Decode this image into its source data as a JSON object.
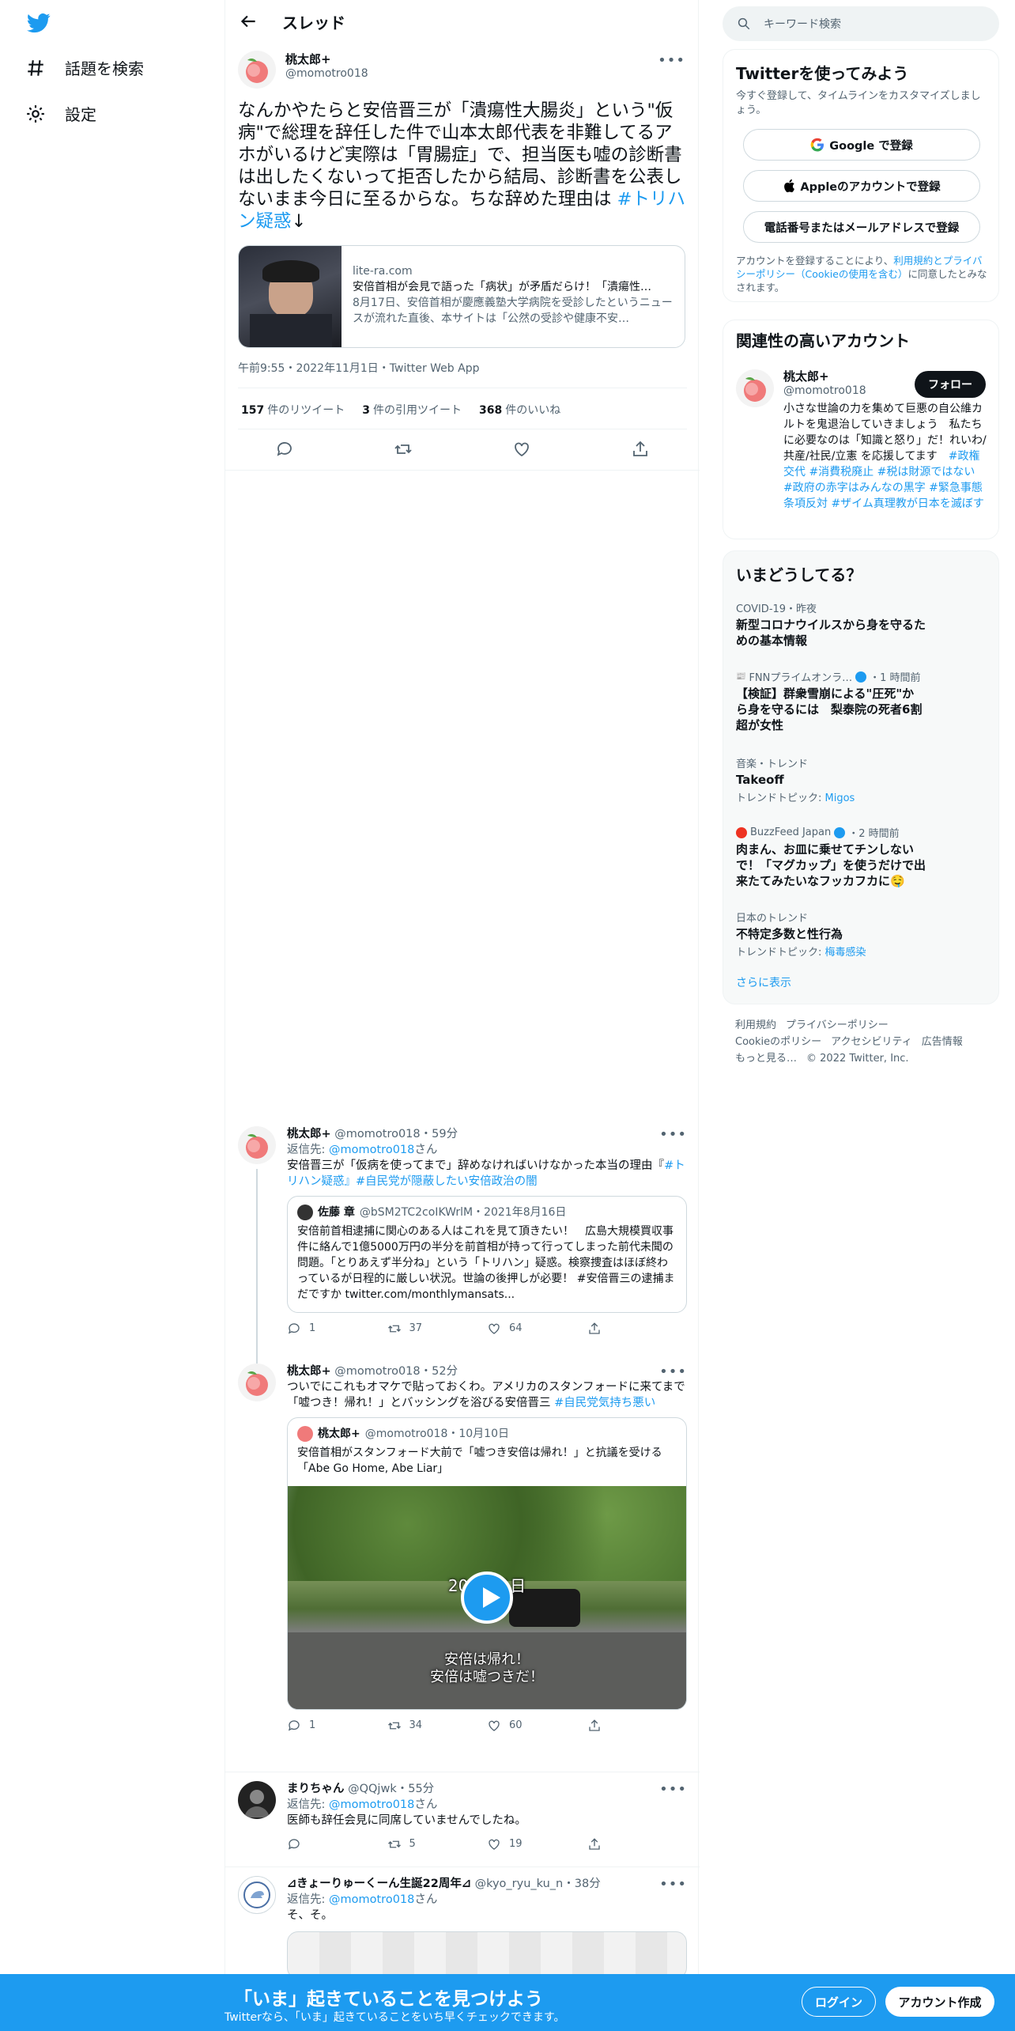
{
  "nav": {
    "explore_label": "話題を検索",
    "settings_label": "設定"
  },
  "header": {
    "title": "スレッド"
  },
  "main_tweet": {
    "author_name": "桃太郎+",
    "author_handle": "@momotro018",
    "text": "なんかやたらと安倍晋三が「潰瘍性大腸炎」という\"仮病\"で総理を辞任した件で山本太郎代表を非難してるアホがいるけど実際は「胃腸症」で、担当医も嘘の診断書は出したくないって拒否したから結局、診断書を公表しないまま今日に至るからな。ちな辞めた理由は ",
    "hashtag": "#トリハン疑惑",
    "text_tail": "↓",
    "card": {
      "domain": "lite-ra.com",
      "title": "安倍首相が会見で語った「病状」が矛盾だらけ！「潰瘍性…",
      "description": "8月17日、安倍首相が慶應義塾大学病院を受診したというニュースが流れた直後、本サイトは「公然の受診や健康不安…"
    },
    "timestamp": "午前9:55・2022年11月1日・Twitter Web App",
    "retweets": "157",
    "retweets_label": "件のリツイート",
    "quotes": "3",
    "quotes_label": "件の引用ツイート",
    "likes": "368",
    "likes_label": "件のいいね"
  },
  "replies": [
    {
      "author_name": "桃太郎+",
      "meta": "@momotro018・59分",
      "reply_to_prefix": "返信先: ",
      "reply_to_handle": "@momotro018",
      "reply_to_suffix": "さん",
      "text": "安倍晋三が「仮病を使ってまで」辞めなければいけなかった本当の理由『",
      "text_links": "#トリハン疑惑』#自民党が隠蔽したい安倍政治の闇",
      "quote": {
        "author": "佐藤 章",
        "meta": "@bSM2TC2coIKWrlM・2021年8月16日",
        "text": "安倍前首相逮捕に関心のある人はこれを見て頂きたい！　広島大規模買収事件に絡んで1億5000万円の半分を前首相が持って行ってしまった前代未聞の問題。「とりあえず半分ね」という「トリハン」疑惑。検察捜査はほぼ終わっているが日程的に厳しい状況。世論の後押しが必要！ #安倍晋三の逮捕まだですか twitter.com/monthlymansats..."
      },
      "reply_count": "1",
      "retweet_count": "37",
      "like_count": "64"
    },
    {
      "author_name": "桃太郎+",
      "meta": "@momotro018・52分",
      "text": "ついでにこれもオマケで貼っておくわ。アメリカのスタンフォードに来てまで「嘘つき！帰れ！」とバッシングを浴びる安倍晋三 ",
      "text_links": "#自民党気持ち悪い",
      "quote": {
        "author": "桃太郎+",
        "meta": "@momotro018・10月10日",
        "text": "安倍首相がスタンフォード大前で「嘘つき安倍は帰れ！」と抗議を受ける「Abe Go Home, Abe Liar」",
        "video_overlay_date": "20　　1日",
        "video_caption_1": "安倍は帰れ！",
        "video_caption_2": "安倍は嘘つきだ！"
      },
      "reply_count": "1",
      "retweet_count": "34",
      "like_count": "60"
    },
    {
      "author_name": "まりちゃん",
      "meta": "@QQjwk・55分",
      "reply_to_prefix": "返信先: ",
      "reply_to_handle": "@momotro018",
      "reply_to_suffix": "さん",
      "text": "医師も辞任会見に同席していませんでしたね。",
      "reply_count": "",
      "retweet_count": "5",
      "like_count": "19"
    },
    {
      "author_name": "⊿きょーりゅーくーん生誕22周年⊿",
      "meta": "@kyo_ryu_ku_n・38分",
      "reply_to_prefix": "返信先: ",
      "reply_to_handle": "@momotro018",
      "reply_to_suffix": "さん",
      "text": "そ、そ。"
    }
  ],
  "right": {
    "search_placeholder": "キーワード検索",
    "signup_card": {
      "title": "Twitterを使ってみよう",
      "subtitle": "今すぐ登録して、タイムラインをカスタマイズしましょう。",
      "google_btn": "Google で登録",
      "apple_btn": "Appleのアカウントで登録",
      "phone_btn": "電話番号またはメールアドレスで登録",
      "terms_prefix": "アカウントを登録することにより、",
      "terms_link": "利用規約とプライバシーポリシー（Cookieの使用を含む）",
      "terms_suffix": "に同意したとみなされます。"
    },
    "related": {
      "title": "関連性の高いアカウント",
      "name": "桃太郎+",
      "handle": "@momotro018",
      "follow_label": "フォロー",
      "bio": "小さな世論の力を集めて巨悪の自公維カルトを鬼退治していきましょう　私たちに必要なのは「知識と怒り」だ！れいわ/共産/社民/立憲 を応援してます　",
      "bio_links": "#政権交代 #消費税廃止 #税は財源ではない #政府の赤字はみんなの黒字 #緊急事態条項反対 #ザイム真理教が日本を滅ぼす"
    },
    "trends": {
      "title": "いまどうしてる？",
      "items": [
        {
          "meta": "COVID-19・昨夜",
          "title": "新型コロナウイルスから身を守るための基本情報",
          "sub": ""
        },
        {
          "meta": "FNNプライムオンラ…",
          "meta_time": "・1 時間前",
          "title": "【検証】群衆雪崩による\"圧死\"から身を守るには　梨泰院の死者6割超が女性",
          "sub": ""
        },
        {
          "meta": "音楽・トレンド",
          "title": "Takeoff",
          "sub": "トレンドトピック: ",
          "sub_link": "Migos"
        },
        {
          "meta": "BuzzFeed Japan",
          "meta_time": "・2 時間前",
          "title": "肉まん、お皿に乗せてチンしないで！「マグカップ」を使うだけで出来たてみたいなフッカフカに🤤",
          "sub": ""
        },
        {
          "meta": "日本のトレンド",
          "title": "不特定多数と性行為",
          "sub": "トレンドトピック: ",
          "sub_link": "梅毒感染"
        }
      ],
      "show_more": "さらに表示"
    },
    "footer": {
      "terms": "利用規約",
      "privacy": "プライバシーポリシー",
      "cookie": "Cookieのポリシー",
      "accessibility": "アクセシビリティ",
      "ads": "広告情報",
      "more": "もっと見る…",
      "copyright": "© 2022 Twitter, Inc."
    }
  },
  "banner": {
    "title": "「いま」起きていることを見つけよう",
    "subtitle": "Twitterなら、「いま」起きていることをいち早くチェックできます。",
    "login": "ログイン",
    "signup": "アカウント作成"
  },
  "colors": {
    "accent": "#1d9bf0",
    "text": "#0f1419",
    "muted": "#536471"
  }
}
